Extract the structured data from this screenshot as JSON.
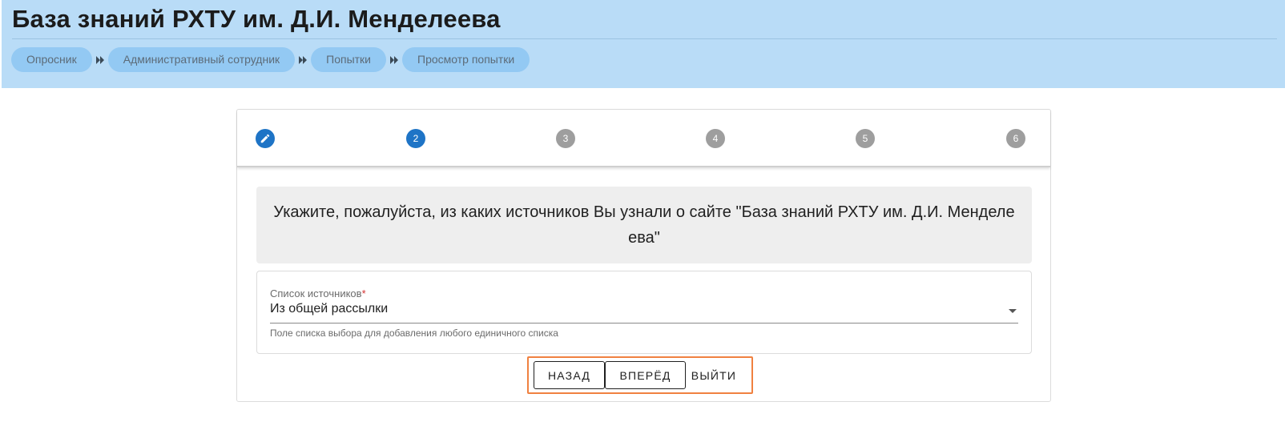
{
  "app": {
    "title": "База знаний РХТУ им. Д.И. Менделеева"
  },
  "breadcrumb": [
    {
      "label": "Опросник"
    },
    {
      "label": "Административный сотрудник"
    },
    {
      "label": "Попытки"
    },
    {
      "label": "Просмотр попытки"
    }
  ],
  "stepper": {
    "current_step": 2,
    "steps": [
      {
        "label": "",
        "icon": "pencil-icon",
        "state": "edit"
      },
      {
        "label": "2",
        "state": "active"
      },
      {
        "label": "3",
        "state": "pending"
      },
      {
        "label": "4",
        "state": "pending"
      },
      {
        "label": "5",
        "state": "pending"
      },
      {
        "label": "6",
        "state": "pending"
      }
    ]
  },
  "question": {
    "text": "Укажите, пожалуйста, из каких источников Вы узнали о сайте \"База знаний РХТУ им. Д.И. Менделеева\""
  },
  "field": {
    "label": "Список источников",
    "required_mark": "*",
    "value": "Из общей рассылки",
    "hint": "Поле списка выбора для добавления любого единичного списка",
    "icon": "chevron-down-icon"
  },
  "actions": {
    "back_label": "Назад",
    "next_label": "Вперёд",
    "exit_label": "Выйти"
  },
  "colors": {
    "header_bg": "#b9dcf7",
    "crumb_bg": "#93c9f3",
    "active_step": "#1e74c6",
    "pending_step": "#9e9e9e",
    "highlight": "#f08140"
  }
}
